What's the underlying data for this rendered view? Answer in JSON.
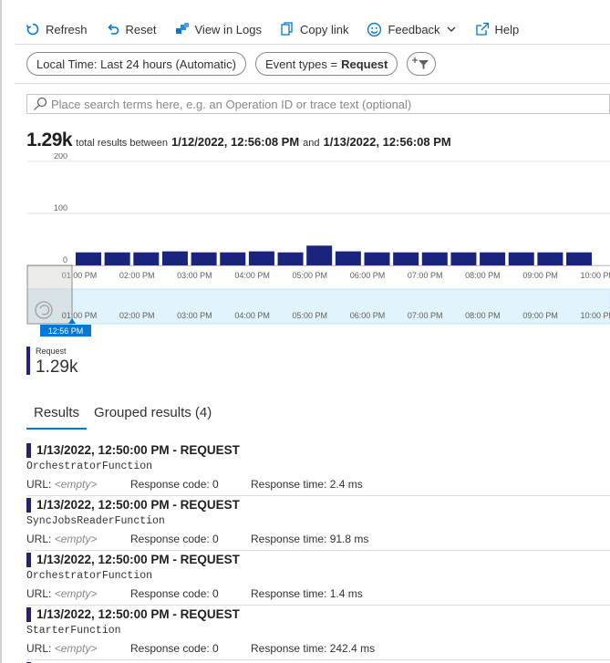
{
  "toolbar": {
    "refresh": "Refresh",
    "reset": "Reset",
    "view_in_logs": "View in Logs",
    "copy_link": "Copy link",
    "feedback": "Feedback",
    "help": "Help"
  },
  "filters": {
    "time": "Local Time: Last 24 hours (Automatic)",
    "event_types_prefix": "Event types =",
    "event_types_value": "Request"
  },
  "search": {
    "placeholder": "Place search terms here, e.g. an Operation ID or trace text (optional)"
  },
  "summary": {
    "count": "1.29k",
    "text": "total results between",
    "start": "1/12/2022, 12:56:08 PM",
    "and": "and",
    "end": "1/13/2022, 12:56:08 PM"
  },
  "colors": {
    "accent": "#0078d4",
    "bar": "#1a237e",
    "brush": "#e1f3fb"
  },
  "chart_data": {
    "type": "bar",
    "yticks": [
      "200",
      "100",
      "0"
    ],
    "ylim": [
      0,
      200
    ],
    "xticks": [
      "01:00 PM",
      "02:00 PM",
      "03:00 PM",
      "04:00 PM",
      "05:00 PM",
      "06:00 PM",
      "07:00 PM",
      "08:00 PM",
      "09:00 PM",
      "10:00 PM"
    ],
    "values": [
      25,
      25,
      25,
      27,
      25,
      25,
      27,
      25,
      38,
      27,
      25,
      25,
      25,
      25,
      25,
      25,
      25,
      25
    ],
    "brush_label": "12:56 PM"
  },
  "legend": {
    "label": "Request",
    "value": "1.29k"
  },
  "tabs": [
    {
      "label": "Results"
    },
    {
      "label": "Grouped results (4)"
    }
  ],
  "results": [
    {
      "time": "1/13/2022, 12:50:00 PM",
      "sep": "-",
      "type": "REQUEST",
      "name": "OrchestratorFunction",
      "url_label": "URL:",
      "url_value": "<empty>",
      "code": "Response code: 0",
      "rt": "Response time: 2.4 ms"
    },
    {
      "time": "1/13/2022, 12:50:00 PM",
      "sep": "-",
      "type": "REQUEST",
      "name": "SyncJobsReaderFunction",
      "url_label": "URL:",
      "url_value": "<empty>",
      "code": "Response code: 0",
      "rt": "Response time: 91.8 ms"
    },
    {
      "time": "1/13/2022, 12:50:00 PM",
      "sep": "-",
      "type": "REQUEST",
      "name": "OrchestratorFunction",
      "url_label": "URL:",
      "url_value": "<empty>",
      "code": "Response code: 0",
      "rt": "Response time: 1.4 ms"
    },
    {
      "time": "1/13/2022, 12:50:00 PM",
      "sep": "-",
      "type": "REQUEST",
      "name": "StarterFunction",
      "url_label": "URL:",
      "url_value": "<empty>",
      "code": "Response code: 0",
      "rt": "Response time: 242.4 ms"
    }
  ]
}
